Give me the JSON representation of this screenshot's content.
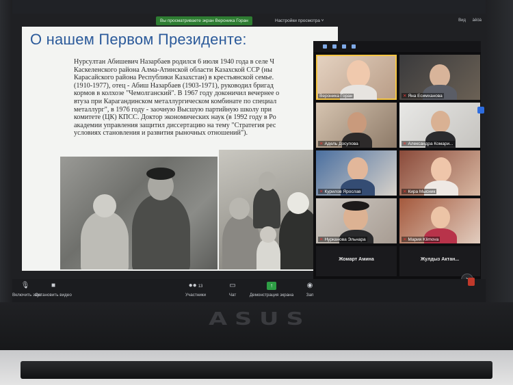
{
  "window": {
    "share_banner": "Вы просматриваете экран Вероника Горан",
    "view_options": "Настройки просмотра ˅",
    "top_right": [
      "Вид",
      "àêòà"
    ]
  },
  "slide": {
    "title": "О нашем Первом Президенте:",
    "lines": [
      "Нурсултан Абишевич Назарбаев родился 6 июля 1940 года в селе Ч",
      "Каскеленского района Алма-Атинской области Казахской ССР (ны",
      "Карасайского района Республики Казахстан) в крестьянской семье.",
      "(1910-1977), отец - Абиш Назарбаев (1903-1971), руководил бригад",
      "кормов в колхозе \"Чемолганский\". В 1967 году доконичил вечернее о",
      "втуза при Карагандинском металлургическом комбинате по специал",
      "металлург\", в 1976 году - заочную Высшую партийную школу при",
      "комитете (ЦК) КПСС. Доктор экономических наук (в 1992 году в Ро",
      "академии управления защитил диссертацию на тему \"Стратегия рес",
      "условиях становления и развития рыночных отношений\")."
    ]
  },
  "gallery": {
    "participants": [
      {
        "name": "Вероника Горан",
        "muted": false,
        "active": true
      },
      {
        "name": "Яна Есимханова",
        "muted": true,
        "active": false
      },
      {
        "name": "Адель Досупова",
        "muted": true,
        "active": false
      },
      {
        "name": "Александра Комари...",
        "muted": true,
        "active": false
      },
      {
        "name": "Курилов Ярослав",
        "muted": true,
        "active": false
      },
      {
        "name": "Кира Мысник",
        "muted": true,
        "active": false
      },
      {
        "name": "Нурканова Эльнара",
        "muted": true,
        "active": false
      },
      {
        "name": "Мария Klimova",
        "muted": true,
        "active": false
      }
    ],
    "audio_only": [
      "Жомарт Амина",
      "Жулдыз Актан..."
    ],
    "next_symbol": "›"
  },
  "toolbar": {
    "unmute": "Включить звук",
    "stop_video": "Остановить видео",
    "participants": "Участники",
    "participants_count": "13",
    "chat": "Чат",
    "share_screen": "Демонстрация экрана",
    "record": "Зап"
  },
  "device": {
    "brand": "ASUS"
  },
  "colors": {
    "title_blue": "#2b5a9a",
    "share_green": "#2e7d32",
    "active_speaker": "#f5c542",
    "mute_red": "#e53935"
  }
}
